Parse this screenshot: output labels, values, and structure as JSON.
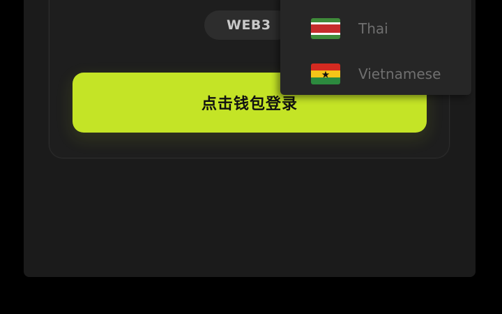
{
  "login_card": {
    "web3_tag": "WEB3",
    "login_button_label": "点击钱包登录"
  },
  "language_dropdown": {
    "items": [
      {
        "label": "Thai",
        "flag_icon": "suriname-style-flag-icon",
        "flag_colors": [
          "#3f8b3a",
          "#ffffff",
          "#c62c2c",
          "#ffffff",
          "#3f8b3a"
        ]
      },
      {
        "label": "Vietnamese",
        "flag_icon": "ghana-style-flag-icon",
        "flag_colors": [
          "#d42a20",
          "#f5c518",
          "#2c8a3e",
          "#111111"
        ]
      }
    ]
  },
  "colors": {
    "accent": "#c4e426",
    "background": "#000000",
    "panel": "#1b1b1b",
    "dropdown": "#262626"
  }
}
